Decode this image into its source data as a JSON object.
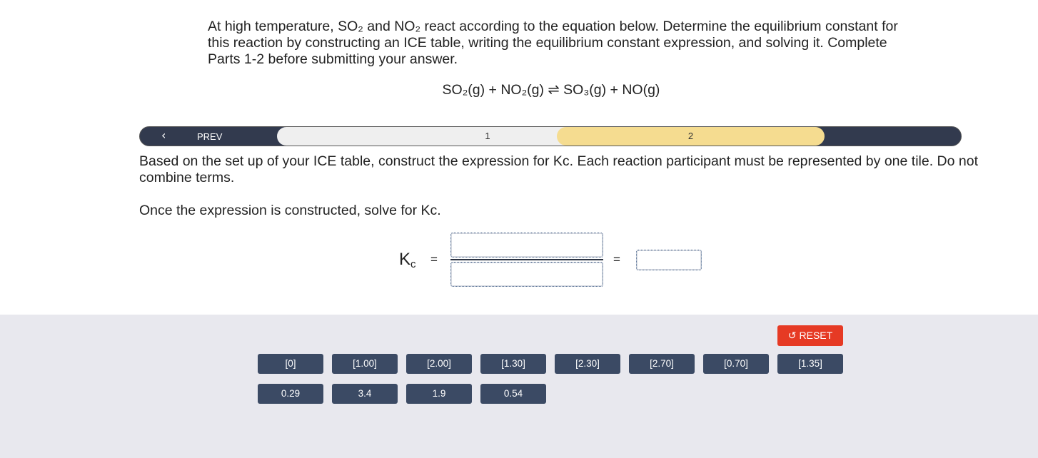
{
  "intro": "At high temperature, SO₂ and NO₂ react according to the equation below. Determine the equilibrium constant for this reaction by constructing an ICE table, writing the equilibrium constant expression, and solving it. Complete Parts 1-2 before submitting your answer.",
  "equation": "SO₂(g) + NO₂(g) ⇌ SO₃(g) + NO(g)",
  "nav": {
    "prev_label": "PREV",
    "steps": [
      "1",
      "2"
    ],
    "active_step": 2
  },
  "instructions": [
    "Based on the set up of your ICE table, construct the expression for Kc. Each reaction participant must be represented by one tile. Do not combine terms.",
    "Once the expression is constructed, solve for Kc."
  ],
  "expression": {
    "k_symbol": "K",
    "k_subscript": "c",
    "equals": "="
  },
  "reset_label": "RESET",
  "tiles_row1": [
    "[0]",
    "[1.00]",
    "[2.00]",
    "[1.30]",
    "[2.30]",
    "[2.70]",
    "[0.70]",
    "[1.35]"
  ],
  "tiles_row2": [
    "0.29",
    "3.4",
    "1.9",
    "0.54"
  ],
  "colors": {
    "nav_bg": "#323a4e",
    "step_active": "#f5dc90",
    "tile_bg": "#3b4a64",
    "reset_bg": "#e63a24",
    "tray_bg": "#e8e8ee"
  }
}
